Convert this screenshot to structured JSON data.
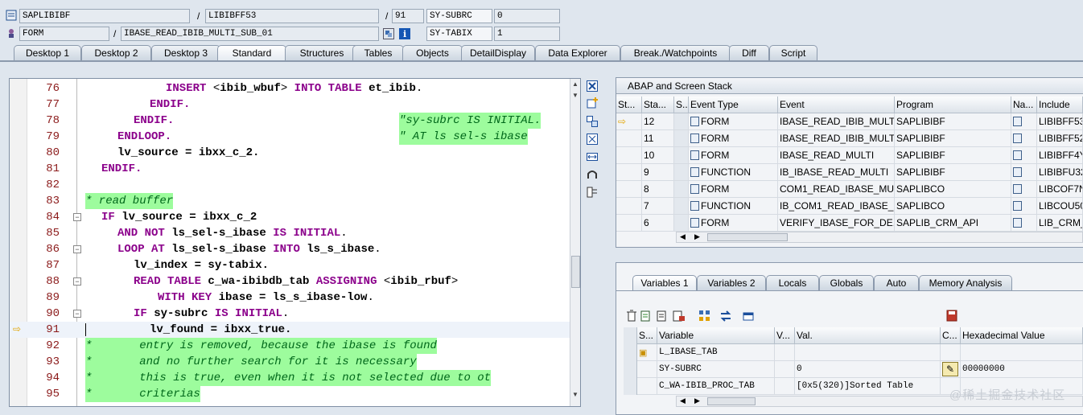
{
  "header": {
    "program": "SAPLIBIBF",
    "include": "LIBIBFF53",
    "line": "91",
    "field1_name": "SY-SUBRC",
    "field1_value": "0",
    "type": "FORM",
    "routine": "IBASE_READ_IBIB_MULTI_SUB_01",
    "field2_name": "SY-TABIX",
    "field2_value": "1"
  },
  "tabs": [
    "Desktop 1",
    "Desktop 2",
    "Desktop 3",
    "Standard",
    "Structures",
    "Tables",
    "Objects",
    "DetailDisplay",
    "Data Explorer",
    "Break./Watchpoints",
    "Diff",
    "Script"
  ],
  "active_tab": "Standard",
  "code": [
    {
      "n": "76",
      "t": "INSERT <ibib_wbuf> INTO TABLE et_ibib."
    },
    {
      "n": "77",
      "t": "ENDIF."
    },
    {
      "n": "78",
      "t": "ENDIF.",
      "c": "\"sy-subrc IS INITIAL."
    },
    {
      "n": "79",
      "t": "ENDLOOP.",
      "c": "\" AT ls sel-s ibase"
    },
    {
      "n": "80",
      "t": "lv_source = ibxx_c_2."
    },
    {
      "n": "81",
      "t": "ENDIF."
    },
    {
      "n": "82",
      "t": ""
    },
    {
      "n": "83",
      "t": "* read buffer"
    },
    {
      "n": "84",
      "t": "IF lv_source = ibxx_c_2"
    },
    {
      "n": "85",
      "t": "AND NOT ls_sel-s_ibase IS INITIAL."
    },
    {
      "n": "86",
      "t": "LOOP AT ls_sel-s_ibase INTO ls_s_ibase."
    },
    {
      "n": "87",
      "t": "lv_index = sy-tabix."
    },
    {
      "n": "88",
      "t": "READ TABLE c_wa-ibibdb_tab ASSIGNING <ibib_rbuf>"
    },
    {
      "n": "89",
      "t": "WITH KEY ibase = ls_s_ibase-low."
    },
    {
      "n": "90",
      "t": "IF sy-subrc IS INITIAL."
    },
    {
      "n": "91",
      "t": "lv_found = ibxx_true."
    },
    {
      "n": "92",
      "t": "*       entry is removed, because the ibase is found"
    },
    {
      "n": "93",
      "t": "*       and no further search for it is necessary"
    },
    {
      "n": "94",
      "t": "*       this is true, even when it is not selected due to ot"
    },
    {
      "n": "95",
      "t": "*       criterias"
    }
  ],
  "stack": {
    "title": "ABAP and Screen Stack",
    "columns": [
      "St...",
      "Sta...",
      "S...",
      "Event Type",
      "Event",
      "Program",
      "Na...",
      "Include"
    ],
    "rows": [
      {
        "level": "12",
        "type": "FORM",
        "event": "IBASE_READ_IBIB_MULT...",
        "program": "SAPLIBIBF",
        "include": "LIBIBFF53"
      },
      {
        "level": "11",
        "type": "FORM",
        "event": "IBASE_READ_IBIB_MULTI",
        "program": "SAPLIBIBF",
        "include": "LIBIBFF52"
      },
      {
        "level": "10",
        "type": "FORM",
        "event": "IBASE_READ_MULTI",
        "program": "SAPLIBIBF",
        "include": "LIBIBFF4Y"
      },
      {
        "level": "9",
        "type": "FUNCTION",
        "event": "IB_IBASE_READ_MULTI",
        "program": "SAPLIBIBF",
        "include": "LIBIBFU32"
      },
      {
        "level": "8",
        "type": "FORM",
        "event": "COM1_READ_IBASE_MU...",
        "program": "SAPLIBCO",
        "include": "LIBCOF7N"
      },
      {
        "level": "7",
        "type": "FUNCTION",
        "event": "IB_COM1_READ_IBASE_...",
        "program": "SAPLIBCO",
        "include": "LIBCOU50"
      },
      {
        "level": "6",
        "type": "FORM",
        "event": "VERIFY_IBASE_FOR_DE...",
        "program": "SAPLIB_CRM_API",
        "include": "LIB_CRM_"
      }
    ]
  },
  "var_tabs": [
    "Variables 1",
    "Variables 2",
    "Locals",
    "Globals",
    "Auto",
    "Memory Analysis"
  ],
  "variables": {
    "columns": [
      "S...",
      "Variable",
      "V...",
      "Val.",
      "C...",
      "Hexadecimal Value"
    ],
    "rows": [
      {
        "name": "L_IBASE_TAB",
        "value": "",
        "hex": ""
      },
      {
        "name": "SY-SUBRC",
        "value": "0",
        "hex": "00000000"
      },
      {
        "name": "C_WA-IBIB_PROC_TAB",
        "value": "[0x5(320)]Sorted Table",
        "hex": ""
      }
    ]
  },
  "watermark": "@稀土掘金技术社区",
  "colors": {
    "comment_bg": "#9dfc9d",
    "keyword": "#8b008b",
    "line_number": "#8b1a1a"
  }
}
